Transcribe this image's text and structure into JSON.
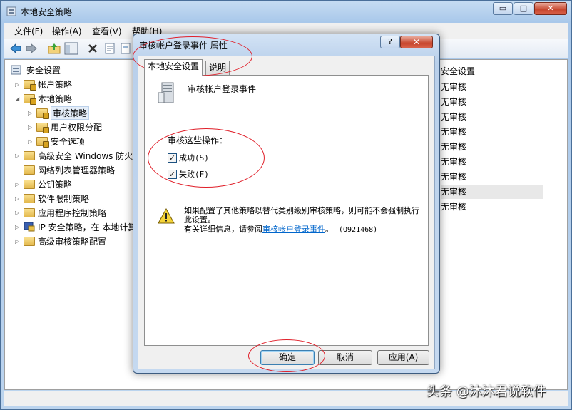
{
  "main_window": {
    "title": "本地安全策略",
    "controls": {
      "minimize": "▭",
      "maximize": "□",
      "close": "✕"
    }
  },
  "menu": [
    "文件(F)",
    "操作(A)",
    "查看(V)",
    "帮助(H)"
  ],
  "tree": {
    "root": "安全设置",
    "items": [
      "帐户策略",
      "本地策略",
      "审核策略",
      "用户权限分配",
      "安全选项",
      "高级安全 Windows 防火",
      "网络列表管理器策略",
      "公钥策略",
      "软件限制策略",
      "应用程序控制策略",
      "IP 安全策略，在 本地计算",
      "高级审核策略配置"
    ]
  },
  "list": {
    "header": "安全设置",
    "rows": [
      "无审核",
      "无审核",
      "无审核",
      "无审核",
      "无审核",
      "无审核",
      "无审核",
      "无审核",
      "无审核"
    ]
  },
  "dialog": {
    "title": "审核帐户登录事件 属性",
    "help": "?",
    "close": "✕",
    "tabs": [
      "本地安全设置",
      "说明"
    ],
    "policy_name": "审核帐户登录事件",
    "audit_label": "审核这些操作：",
    "checkbox_success": "成功(S)",
    "checkbox_failure": "失败(F)",
    "success_checked": true,
    "failure_checked": true,
    "warning_line1": "如果配置了其他策略以替代类别级别审核策略，则可能不会强制执行此设置。",
    "warning_line2_prefix": "有关详细信息，请参阅",
    "warning_link": "审核帐户登录事件",
    "warning_line2_suffix": "。",
    "kb_ref": "(Q921468)",
    "ok": "确定",
    "cancel": "取消",
    "apply": "应用(A)"
  },
  "watermark": "头条 @沐沐君说软件",
  "colors": {
    "annotation": "#e0202a",
    "link": "#0066cc",
    "title_bar": "#b9d0eb"
  }
}
